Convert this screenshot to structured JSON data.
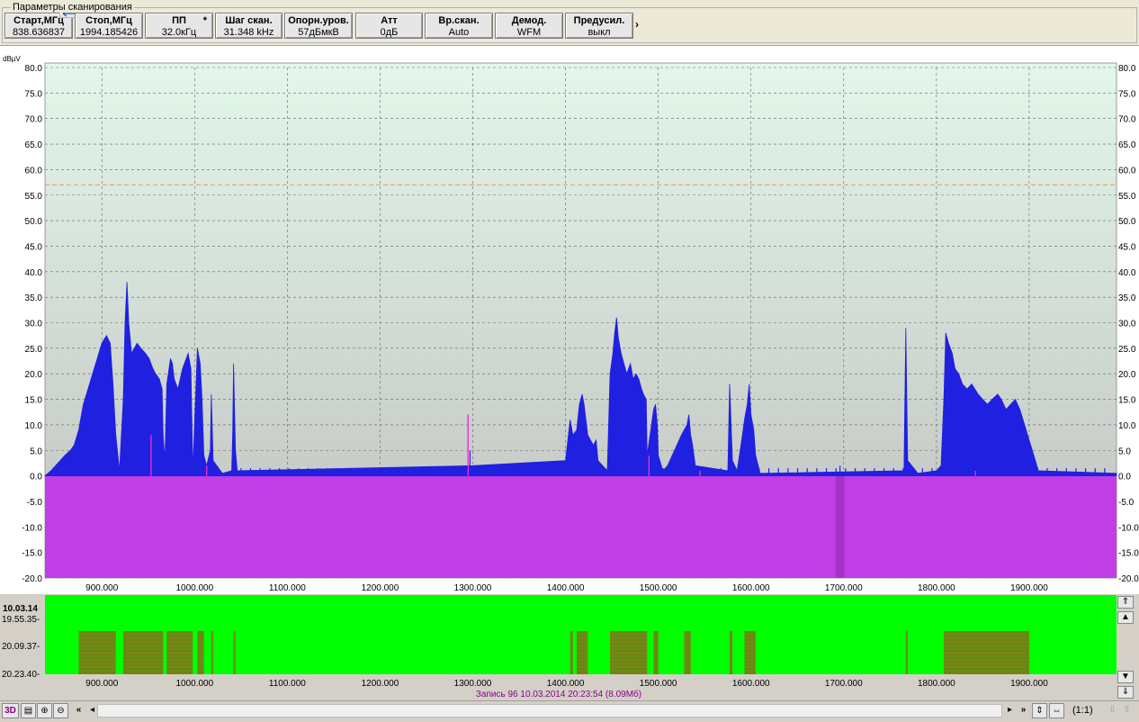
{
  "panel": {
    "title": "Параметры сканирования",
    "params": [
      {
        "label": "Старт,МГц",
        "value": "838.636837"
      },
      {
        "label": "Стоп,МГц",
        "value": "1994.185426"
      },
      {
        "label": "ПП",
        "value": "32.0кГц",
        "marker": "*"
      },
      {
        "label": "Шаг скан.",
        "value": "31.348 kHz"
      },
      {
        "label": "Опорн.уров.",
        "value": "57дБмкВ"
      },
      {
        "label": "Атт",
        "value": "0дБ"
      },
      {
        "label": "Вр.скан.",
        "value": "Auto"
      },
      {
        "label": "Демод.",
        "value": "WFM"
      },
      {
        "label": "Предусил.",
        "value": "выкл"
      }
    ],
    "more": "›"
  },
  "chart_data": {
    "type": "area",
    "unit_label": "dBµV",
    "x_range": [
      838.636837,
      1994.185426
    ],
    "ylim": [
      -20,
      80
    ],
    "y_ticks": [
      "80.0",
      "75.0",
      "70.0",
      "65.0",
      "60.0",
      "55.0",
      "50.0",
      "45.0",
      "40.0",
      "35.0",
      "30.0",
      "25.0",
      "20.0",
      "15.0",
      "10.0",
      "5.0",
      "0.0",
      "-5.0",
      "-10.0",
      "-15.0",
      "-20.0"
    ],
    "x_ticks": [
      "900.000",
      "1000.000",
      "1100.000",
      "1200.000",
      "1300.000",
      "1400.000",
      "1500.000",
      "1600.000",
      "1700.000",
      "1800.000",
      "1900.000"
    ],
    "x_tick_values": [
      900,
      1000,
      1100,
      1200,
      1300,
      1400,
      1500,
      1600,
      1700,
      1800,
      1900
    ],
    "reference_level": 57,
    "colors": {
      "spectrum": "#2020e0",
      "negative_fill": "#c13de6",
      "marker": "#ff33cc",
      "reference": "#f0a040",
      "grid": "#666666",
      "waterfall": "#00ff00"
    },
    "series": [
      {
        "peak_points": [
          [
            838.6,
            0
          ],
          [
            845,
            1
          ],
          [
            850,
            2
          ],
          [
            855,
            3
          ],
          [
            860,
            4
          ],
          [
            866,
            5
          ],
          [
            870,
            6
          ],
          [
            875,
            9
          ],
          [
            880,
            14
          ],
          [
            885,
            17
          ],
          [
            890,
            20
          ],
          [
            895,
            23
          ],
          [
            900,
            26
          ],
          [
            905,
            27.5
          ],
          [
            909,
            26
          ],
          [
            912,
            18
          ],
          [
            915,
            8
          ],
          [
            919,
            1
          ],
          [
            923,
            15
          ],
          [
            925,
            30
          ],
          [
            927,
            38
          ],
          [
            929,
            30
          ],
          [
            932,
            24
          ],
          [
            935,
            25
          ],
          [
            938,
            26
          ],
          [
            942,
            25
          ],
          [
            947,
            24
          ],
          [
            951,
            23
          ],
          [
            955,
            21
          ],
          [
            958,
            20
          ],
          [
            962,
            19
          ],
          [
            965,
            17
          ],
          [
            966,
            8
          ],
          [
            968,
            3
          ],
          [
            970,
            18
          ],
          [
            974,
            23
          ],
          [
            976,
            22
          ],
          [
            978,
            19
          ],
          [
            982,
            17
          ],
          [
            987,
            21
          ],
          [
            991,
            23
          ],
          [
            993,
            24
          ],
          [
            996,
            21
          ],
          [
            998,
            1
          ],
          [
            1003,
            25
          ],
          [
            1006,
            22
          ],
          [
            1008,
            15
          ],
          [
            1010,
            4
          ],
          [
            1013,
            2
          ],
          [
            1017,
            5
          ],
          [
            1018,
            16
          ],
          [
            1020,
            3
          ],
          [
            1030,
            0.5
          ],
          [
            1040,
            1
          ],
          [
            1041,
            8
          ],
          [
            1042,
            22
          ],
          [
            1044,
            5
          ],
          [
            1046,
            1
          ],
          [
            1300,
            2
          ],
          [
            1400,
            3
          ],
          [
            1405,
            11
          ],
          [
            1408,
            8
          ],
          [
            1412,
            9
          ],
          [
            1415,
            14
          ],
          [
            1418,
            16
          ],
          [
            1420,
            14
          ],
          [
            1424,
            8
          ],
          [
            1430,
            6
          ],
          [
            1433,
            7
          ],
          [
            1435,
            3
          ],
          [
            1445,
            1
          ],
          [
            1448,
            20
          ],
          [
            1451,
            24
          ],
          [
            1453,
            28
          ],
          [
            1455,
            31
          ],
          [
            1457,
            27
          ],
          [
            1460,
            24
          ],
          [
            1463,
            22
          ],
          [
            1466,
            20
          ],
          [
            1470,
            22
          ],
          [
            1473,
            19
          ],
          [
            1476,
            20
          ],
          [
            1479,
            19
          ],
          [
            1482,
            17
          ],
          [
            1484,
            16
          ],
          [
            1487,
            15
          ],
          [
            1488,
            4
          ],
          [
            1495,
            13
          ],
          [
            1497,
            14
          ],
          [
            1499,
            10
          ],
          [
            1500,
            4
          ],
          [
            1505,
            1
          ],
          [
            1510,
            2
          ],
          [
            1515,
            4
          ],
          [
            1520,
            6
          ],
          [
            1525,
            8
          ],
          [
            1528,
            9
          ],
          [
            1531,
            10
          ],
          [
            1533,
            12
          ],
          [
            1535,
            8
          ],
          [
            1537,
            6
          ],
          [
            1540,
            2
          ],
          [
            1575,
            1
          ],
          [
            1577,
            18
          ],
          [
            1580,
            3
          ],
          [
            1585,
            1
          ],
          [
            1590,
            7
          ],
          [
            1593,
            11
          ],
          [
            1596,
            14
          ],
          [
            1598,
            18
          ],
          [
            1600,
            12
          ],
          [
            1603,
            9
          ],
          [
            1605,
            4
          ],
          [
            1610,
            0.5
          ],
          [
            1765,
            1
          ],
          [
            1767,
            29
          ],
          [
            1769,
            3
          ],
          [
            1780,
            0.5
          ],
          [
            1800,
            1
          ],
          [
            1805,
            2
          ],
          [
            1808,
            15
          ],
          [
            1810,
            28
          ],
          [
            1813,
            26
          ],
          [
            1817,
            24
          ],
          [
            1820,
            21
          ],
          [
            1824,
            20
          ],
          [
            1828,
            18
          ],
          [
            1833,
            17
          ],
          [
            1838,
            18
          ],
          [
            1845,
            16
          ],
          [
            1850,
            15
          ],
          [
            1855,
            14
          ],
          [
            1860,
            15
          ],
          [
            1866,
            16
          ],
          [
            1870,
            15
          ],
          [
            1875,
            13
          ],
          [
            1880,
            14
          ],
          [
            1885,
            15
          ],
          [
            1890,
            13
          ],
          [
            1895,
            10
          ],
          [
            1900,
            7
          ],
          [
            1905,
            4
          ],
          [
            1910,
            1
          ],
          [
            1994.2,
            0.5
          ]
        ]
      },
      {
        "spikes": [
          [
            953,
            8
          ],
          [
            1295,
            12
          ],
          [
            1297,
            5
          ],
          [
            1490,
            4
          ],
          [
            1696,
            2
          ],
          [
            1842,
            1
          ]
        ]
      }
    ],
    "markers": [
      [
        953,
        8
      ],
      [
        1295,
        12
      ],
      [
        1490,
        4
      ],
      [
        1013,
        2
      ],
      [
        1545,
        1
      ],
      [
        1842,
        1
      ]
    ],
    "cursor_x": 1696
  },
  "waterfall": {
    "date": "10.03.14",
    "times": [
      "19.55.35-",
      "20.09.37-",
      "20.23.40-"
    ],
    "status": "Запись 96 10.03.2014 20:23:54 (8.09Мб)"
  },
  "toolbar": {
    "btn_3d": "3D",
    "ratio": "(1:1)"
  }
}
